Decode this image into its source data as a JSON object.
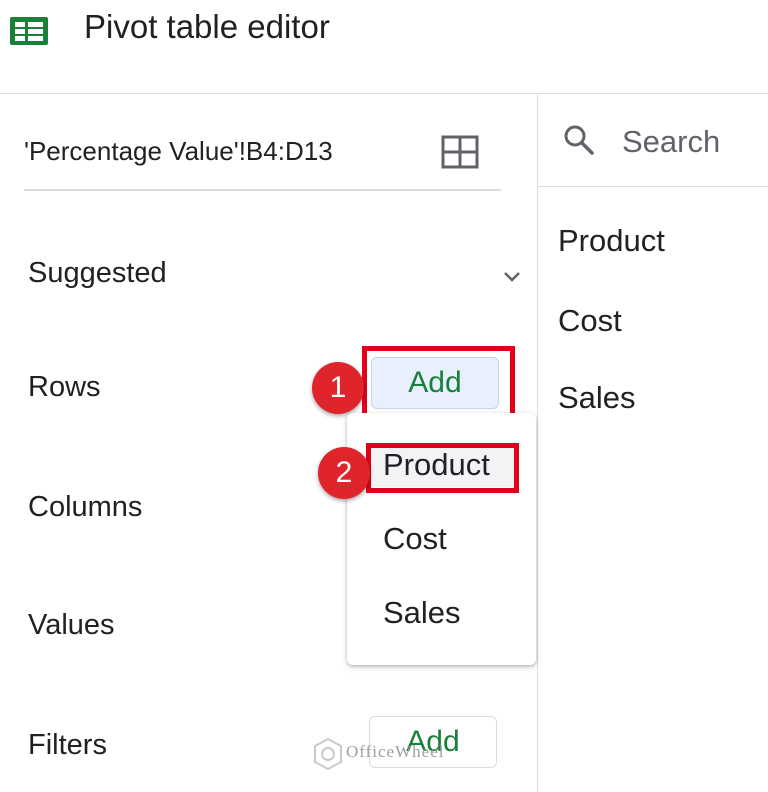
{
  "header": {
    "title": "Pivot table editor",
    "app_icon": "google-sheets-icon",
    "brand_color": "#188038"
  },
  "range": {
    "value": "'Percentage Value'!B4:D13",
    "select_icon": "grid-icon"
  },
  "sections": {
    "suggested": "Suggested",
    "rows": "Rows",
    "columns": "Columns",
    "values": "Values",
    "filters": "Filters"
  },
  "buttons": {
    "rows_add": "Add",
    "filters_add": "Add"
  },
  "dropdown": {
    "items": [
      "Product",
      "Cost",
      "Sales"
    ]
  },
  "annotations": {
    "step1": "1",
    "step2": "2",
    "highlight_color": "#e0001b"
  },
  "search": {
    "placeholder": "Search"
  },
  "fields": [
    "Product",
    "Cost",
    "Sales"
  ],
  "watermark": {
    "text": "OfficeWheel"
  }
}
